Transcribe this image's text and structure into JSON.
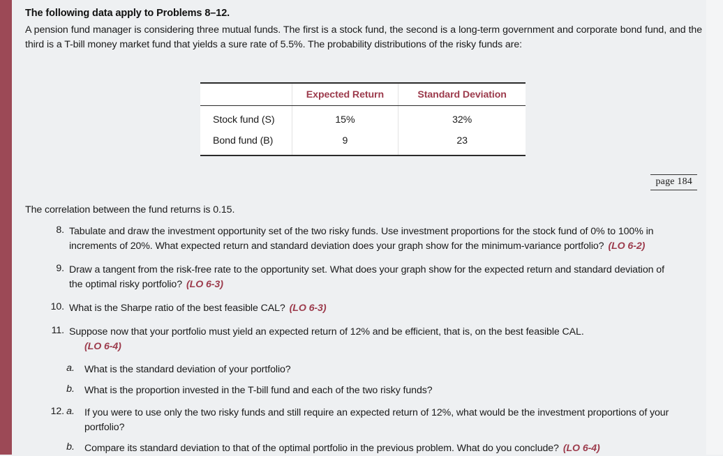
{
  "colors": {
    "accent": "#9c3b4c",
    "left_bar": "#9c4956",
    "page_background": "#eef0f2",
    "table_background": "#ffffff",
    "text": "#1a1a1a"
  },
  "heading": "The following data apply to Problems 8–12.",
  "intro": "A pension fund manager is considering three mutual funds. The first is a stock fund, the second is a long-term government and corporate bond fund, and the third is a T-bill money market fund that yields a sure rate of 5.5%. The probability distributions of the risky funds are:",
  "table": {
    "columns": [
      "",
      "Expected Return",
      "Standard Deviation"
    ],
    "rows": [
      [
        "Stock fund (S)",
        "15%",
        "32%"
      ],
      [
        "Bond fund (B)",
        "9",
        "23"
      ]
    ]
  },
  "page_marker": "page 184",
  "correlation": "The correlation between the fund returns is 0.15.",
  "problems": [
    {
      "number": "8.",
      "text": "Tabulate and draw the investment opportunity set of the two risky funds. Use investment proportions for the stock fund of 0% to 100% in increments of 20%. What expected return and standard deviation does your graph show for the minimum-variance portfolio?",
      "lo": "(LO 6-2)"
    },
    {
      "number": "9.",
      "text": "Draw a tangent from the risk-free rate to the opportunity set. What does your graph show for the expected return and standard deviation of the optimal risky portfolio?",
      "lo": "(LO 6-3)"
    },
    {
      "number": "10.",
      "text": "What is the Sharpe ratio of the best feasible CAL?",
      "lo": "(LO 6-3)"
    },
    {
      "number": "11.",
      "text": "Suppose now that your portfolio must yield an expected return of 12% and be efficient, that is, on the best feasible CAL.",
      "lo": "(LO 6-4)"
    }
  ],
  "problem11_subitems": [
    {
      "label": "a.",
      "text": "What is the standard deviation of your portfolio?"
    },
    {
      "label": "b.",
      "text": "What is the proportion invested in the T-bill fund and each of the two risky funds?"
    }
  ],
  "problem12": {
    "number": "12.",
    "subitems": [
      {
        "label": "a.",
        "text": "If you were to use only the two risky funds and still require an expected return of 12%, what would be the investment proportions of your portfolio?",
        "lo": ""
      },
      {
        "label": "b.",
        "text": "Compare its standard deviation to that of the optimal portfolio in the previous problem. What do you conclude?",
        "lo": "(LO 6-4)"
      }
    ]
  }
}
